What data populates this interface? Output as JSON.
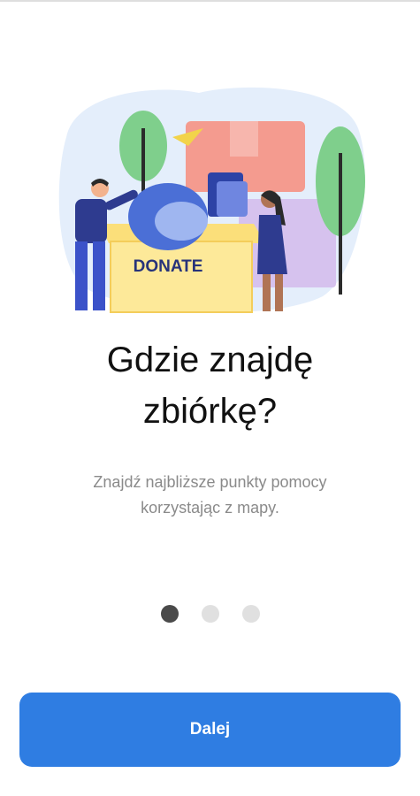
{
  "onboarding": {
    "illustration": {
      "box_label": "DONATE"
    },
    "title_line1": "Gdzie znajdę",
    "title_line2": "zbiórkę?",
    "subtitle_line1": "Znajdź najbliższe punkty pomocy",
    "subtitle_line2": "korzystając z mapy.",
    "pagination": {
      "total": 3,
      "active_index": 0
    },
    "next_button_label": "Dalej"
  },
  "colors": {
    "accent": "#2f7de2",
    "dot_active": "#4a4a4a",
    "dot_inactive": "#e0e0e0"
  }
}
